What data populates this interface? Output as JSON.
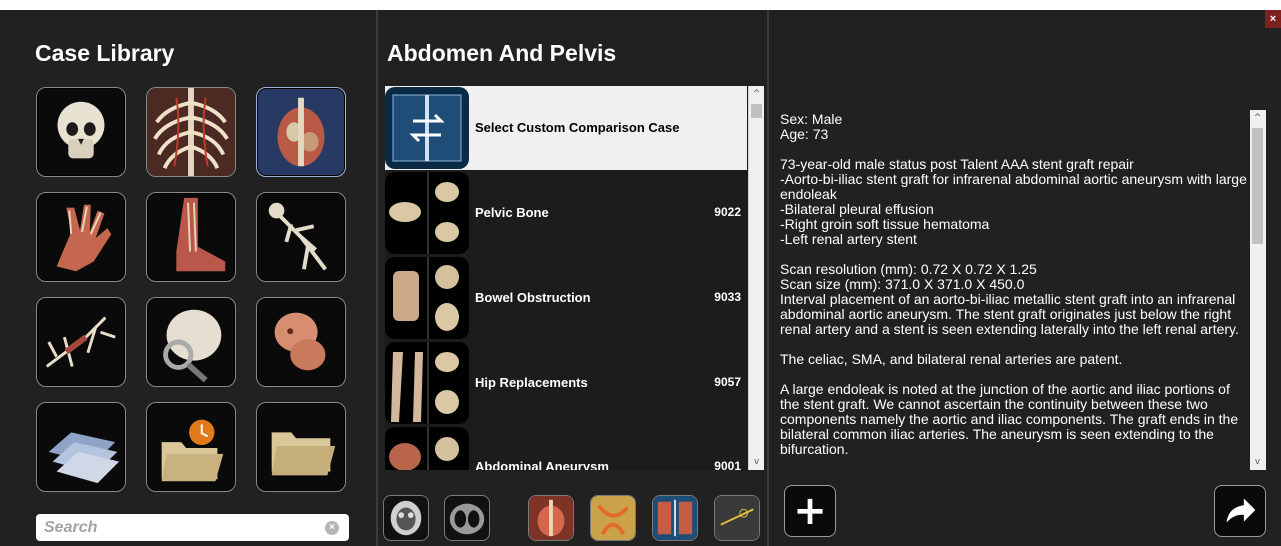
{
  "window": {
    "close_label": "×"
  },
  "left_panel": {
    "title": "Case Library",
    "tiles": [
      {
        "name": "skull-icon"
      },
      {
        "name": "ribcage-icon"
      },
      {
        "name": "torso-icon",
        "selected": true
      },
      {
        "name": "hand-icon"
      },
      {
        "name": "foot-icon"
      },
      {
        "name": "full-skeleton-icon"
      },
      {
        "name": "animal-skeleton-icon"
      },
      {
        "name": "skull-magnifier-icon"
      },
      {
        "name": "fetus-icon"
      },
      {
        "name": "scan-sheets-icon"
      },
      {
        "name": "recent-folder-icon"
      },
      {
        "name": "folder-icon"
      }
    ],
    "search": {
      "placeholder": "Search",
      "value": "",
      "clear_icon": "×"
    }
  },
  "middle_panel": {
    "title": "Abdomen And Pelvis",
    "cases": [
      {
        "label": "Select Custom Comparison Case",
        "id": "",
        "highlight": true
      },
      {
        "label": "Pelvic Bone",
        "id": "9022"
      },
      {
        "label": "Bowel Obstruction",
        "id": "9033"
      },
      {
        "label": "Hip Replacements",
        "id": "9057"
      },
      {
        "label": "Abdominal Aneurysm",
        "id": "9001"
      }
    ],
    "scroll_up": "^",
    "scroll_down": "v",
    "view_buttons": [
      {
        "name": "axial-head-view-icon"
      },
      {
        "name": "axial-chest-view-icon"
      },
      {
        "name": "abdomen-volume-view-icon"
      },
      {
        "name": "vessel-volume-view-icon"
      },
      {
        "name": "compare-view-icon"
      },
      {
        "name": "measurement-view-icon"
      }
    ]
  },
  "right_panel": {
    "paragraphs": [
      "Sex: Male\nAge: 73",
      "73-year-old male status post Talent AAA stent graft repair\n-Aorto-bi-iliac stent graft for infrarenal abdominal aortic aneurysm with large endoleak\n-Bilateral pleural effusion\n-Right groin soft tissue hematoma\n-Left renal artery stent",
      "Scan resolution (mm): 0.72 X 0.72 X 1.25\nScan size (mm): 371.0 X 371.0 X 450.0\nInterval placement of an aorto-bi-iliac metallic stent graft into an infrarenal abdominal aortic aneurysm. The stent graft originates just below the right renal artery and a stent is seen extending laterally into the left renal artery.",
      "The celiac, SMA, and bilateral renal arteries are patent.",
      "A large endoleak is noted at the junction of the aortic and iliac portions of the stent graft. We cannot ascertain the continuity between these two components namely the aortic and iliac components. The graft ends in the bilateral common iliac arteries. The aneurysm is seen extending to the bifurcation."
    ],
    "add_label": "+",
    "share_icon": "share-arrow-icon"
  },
  "colors": {
    "background": "#212121",
    "highlight": "#f0f0f0",
    "selected_tile": "#273a63",
    "close": "#7c2020"
  }
}
